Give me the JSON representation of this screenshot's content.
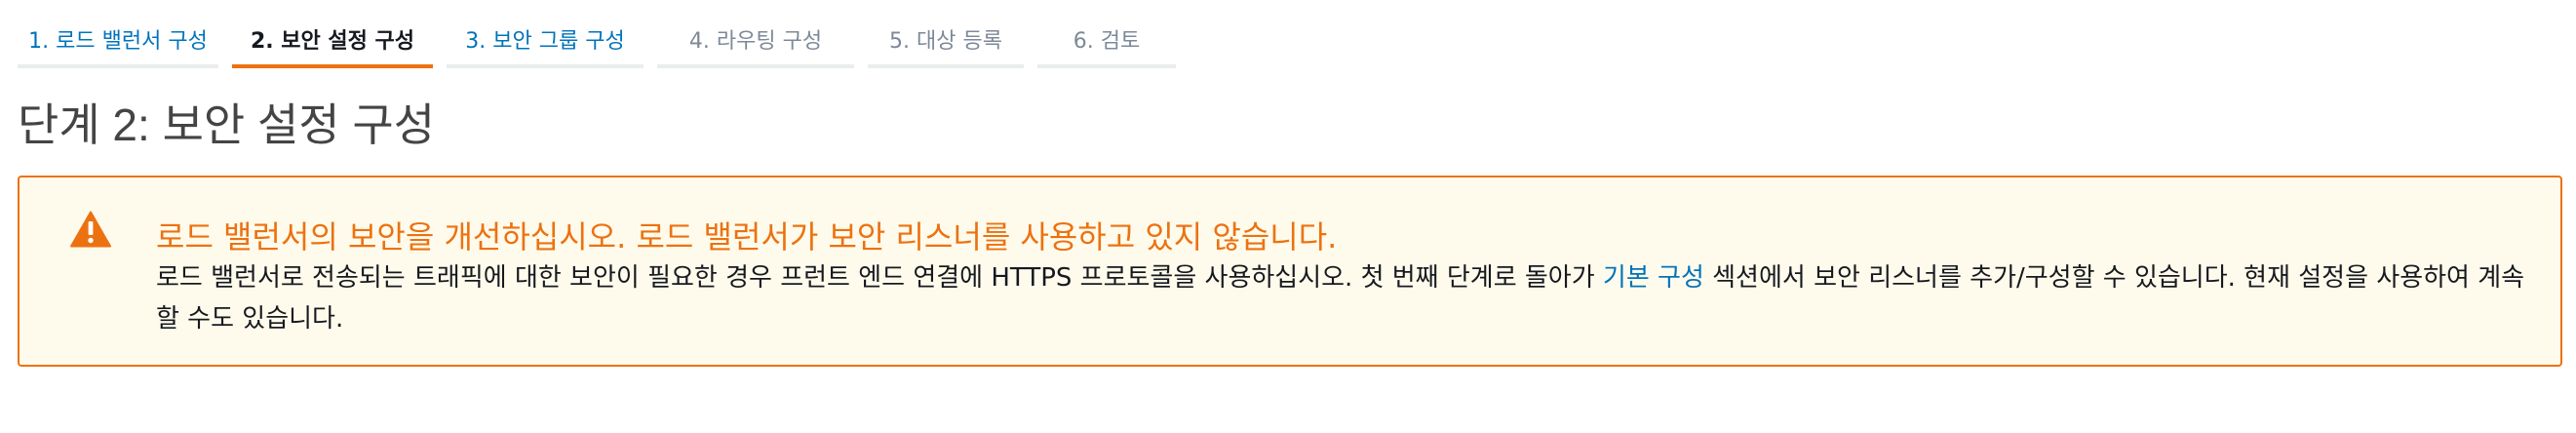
{
  "wizard": {
    "steps": [
      {
        "label": "1. 로드 밸런서 구성",
        "state": "done"
      },
      {
        "label": "2. 보안 설정 구성",
        "state": "active"
      },
      {
        "label": "3. 보안 그룹 구성",
        "state": "done"
      },
      {
        "label": "4. 라우팅 구성",
        "state": "pending"
      },
      {
        "label": "5. 대상 등록",
        "state": "pending"
      },
      {
        "label": "6. 검토",
        "state": "pending"
      }
    ]
  },
  "page": {
    "title": "단계 2: 보안 설정 구성"
  },
  "alert": {
    "type": "warning",
    "icon": "warning-triangle-icon",
    "color": "#ec7211",
    "title": "로드 밸런서의 보안을 개선하십시오. 로드 밸런서가 보안 리스너를 사용하고 있지 않습니다.",
    "body_before_link": "로드 밸런서로 전송되는 트래픽에 대한 보안이 필요한 경우 프런트 엔드 연결에 HTTPS 프로토콜을 사용하십시오. 첫 번째 단계로 돌아가 ",
    "link_text": "기본 구성",
    "body_after_link": " 섹션에서 보안 리스너를 추가/구성할 수 있습니다. 현재 설정을 사용하여 계속할 수도 있습니다."
  }
}
